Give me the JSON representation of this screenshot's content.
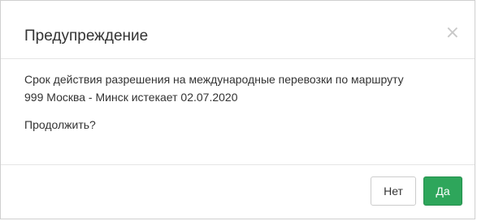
{
  "dialog": {
    "title": "Предупреждение",
    "close_glyph": "×",
    "message_line1": "Срок действия разрешения на международные перевозки по маршруту",
    "message_line2": "999 Москва - Минск истекает 02.07.2020",
    "question": "Продолжить?",
    "buttons": {
      "no_label": "Нет",
      "yes_label": "Да"
    }
  },
  "colors": {
    "primary_button": "#2ea65b",
    "text": "#333333",
    "divider": "#e5e5e5"
  }
}
